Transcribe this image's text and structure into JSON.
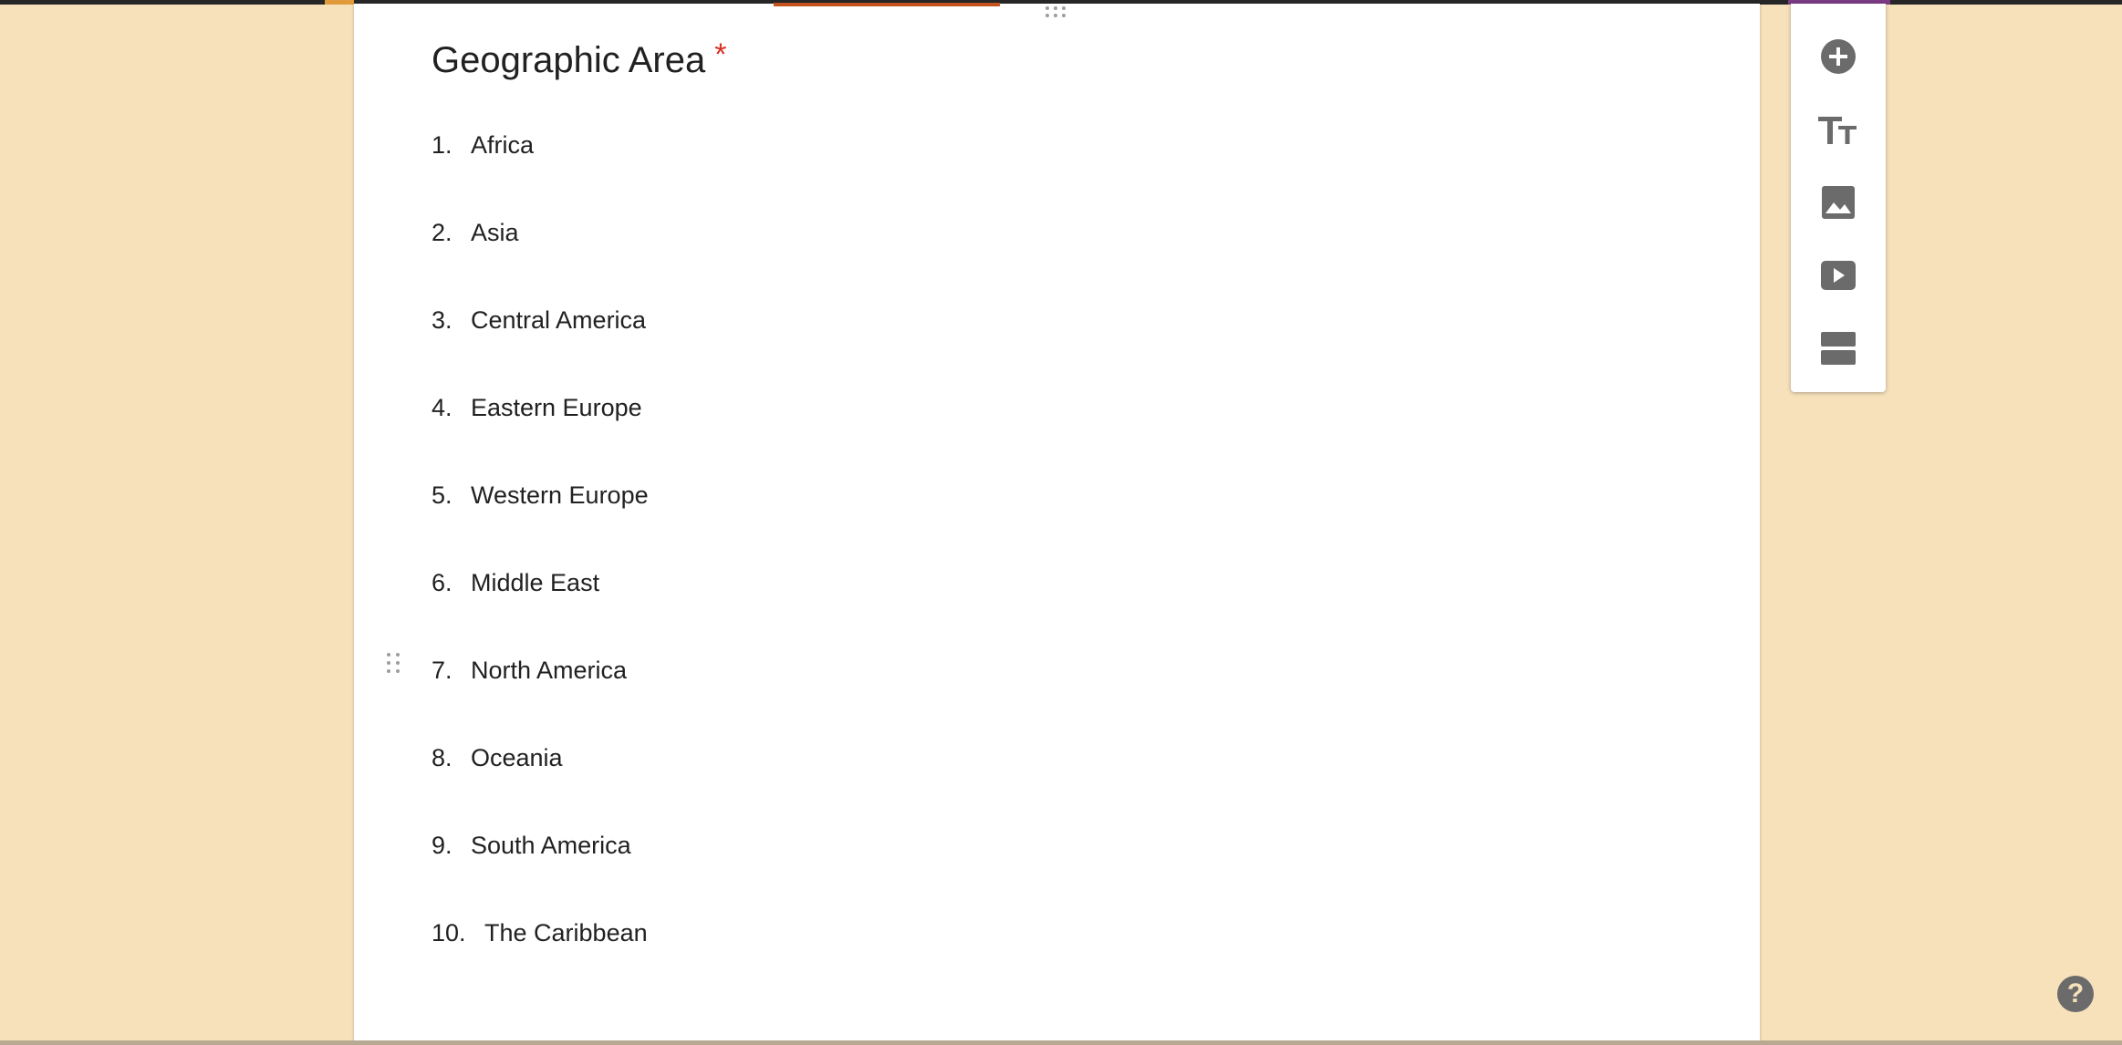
{
  "question": {
    "title": "Geographic Area",
    "required_mark": "*"
  },
  "options": [
    {
      "num": "1.",
      "label": "Africa"
    },
    {
      "num": "2.",
      "label": "Asia"
    },
    {
      "num": "3.",
      "label": "Central America"
    },
    {
      "num": "4.",
      "label": "Eastern Europe"
    },
    {
      "num": "5.",
      "label": "Western Europe"
    },
    {
      "num": "6.",
      "label": "Middle East"
    },
    {
      "num": "7.",
      "label": "North America"
    },
    {
      "num": "8.",
      "label": "Oceania"
    },
    {
      "num": "9.",
      "label": "South America"
    },
    {
      "num": "10.",
      "label": "The Caribbean"
    }
  ],
  "toolbar": {
    "items": [
      "add-question-icon",
      "title-text-icon",
      "image-icon",
      "video-icon",
      "section-icon"
    ]
  },
  "help": {
    "label": "?"
  },
  "colors": {
    "background": "#f6e1bb",
    "accent": "#c4521f",
    "required": "#d93025",
    "icon": "#6b6b6b"
  }
}
